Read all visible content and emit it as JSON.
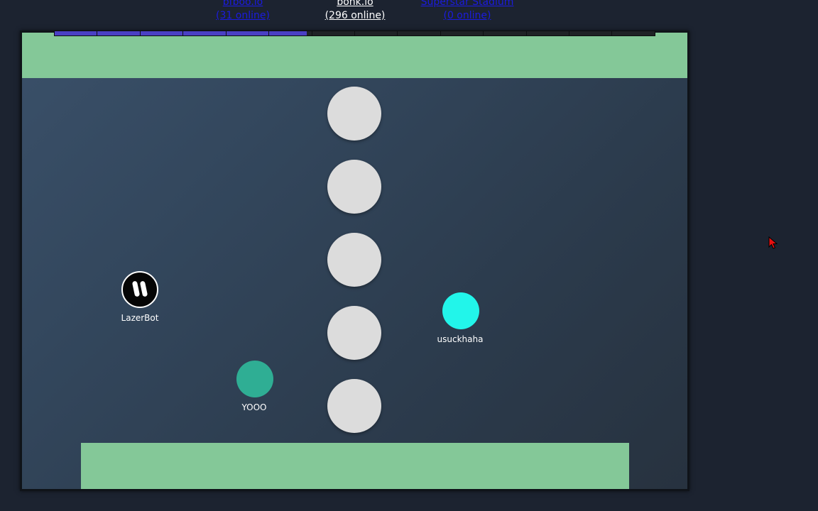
{
  "nav": {
    "left": {
      "name": "bfboo.io",
      "online": "(31 online)"
    },
    "center": {
      "name": "bonk.io",
      "online": "(296 online)"
    },
    "right": {
      "name": "Superstar Stadium",
      "online": "(0 online)"
    }
  },
  "progress": {
    "segments": 14,
    "filled_fraction": 0.42
  },
  "players": [
    {
      "name": "LazerBot",
      "color": "#050505",
      "icon": "pause-icon"
    },
    {
      "name": "YOOO",
      "color": "#2fae94"
    },
    {
      "name": "usuckhaha",
      "color": "#22f5ea"
    }
  ],
  "colors": {
    "platform": "#84c898",
    "obstacle": "#dcdcdc",
    "progress_fill": "#4a3fc4",
    "cursor": "#e81010"
  }
}
